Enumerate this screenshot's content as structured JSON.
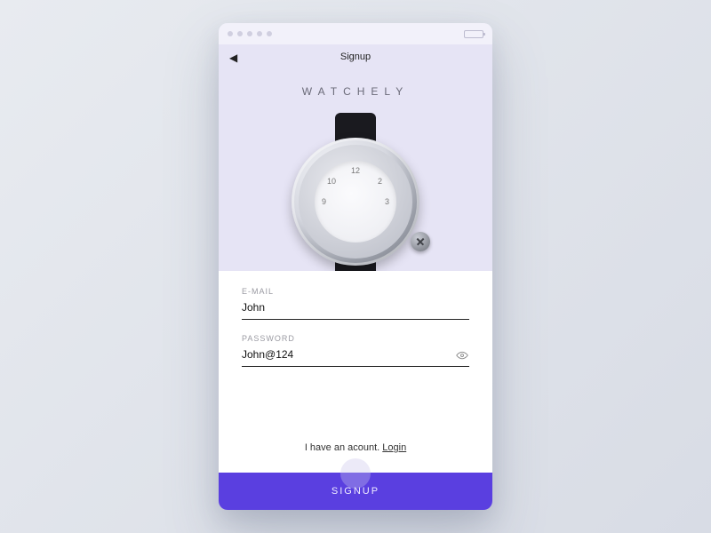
{
  "nav": {
    "title": "Signup"
  },
  "brand": "WATCHELY",
  "form": {
    "email_label": "E-MAIL",
    "email_value": "John",
    "password_label": "PASSWORD",
    "password_value": "John@124"
  },
  "login_row": {
    "text": "I have an acount. ",
    "link": "Login"
  },
  "cta": "SIGNUP",
  "dial": {
    "n12": "12",
    "n2": "2",
    "n3": "3",
    "n9": "9",
    "n10": "10"
  }
}
